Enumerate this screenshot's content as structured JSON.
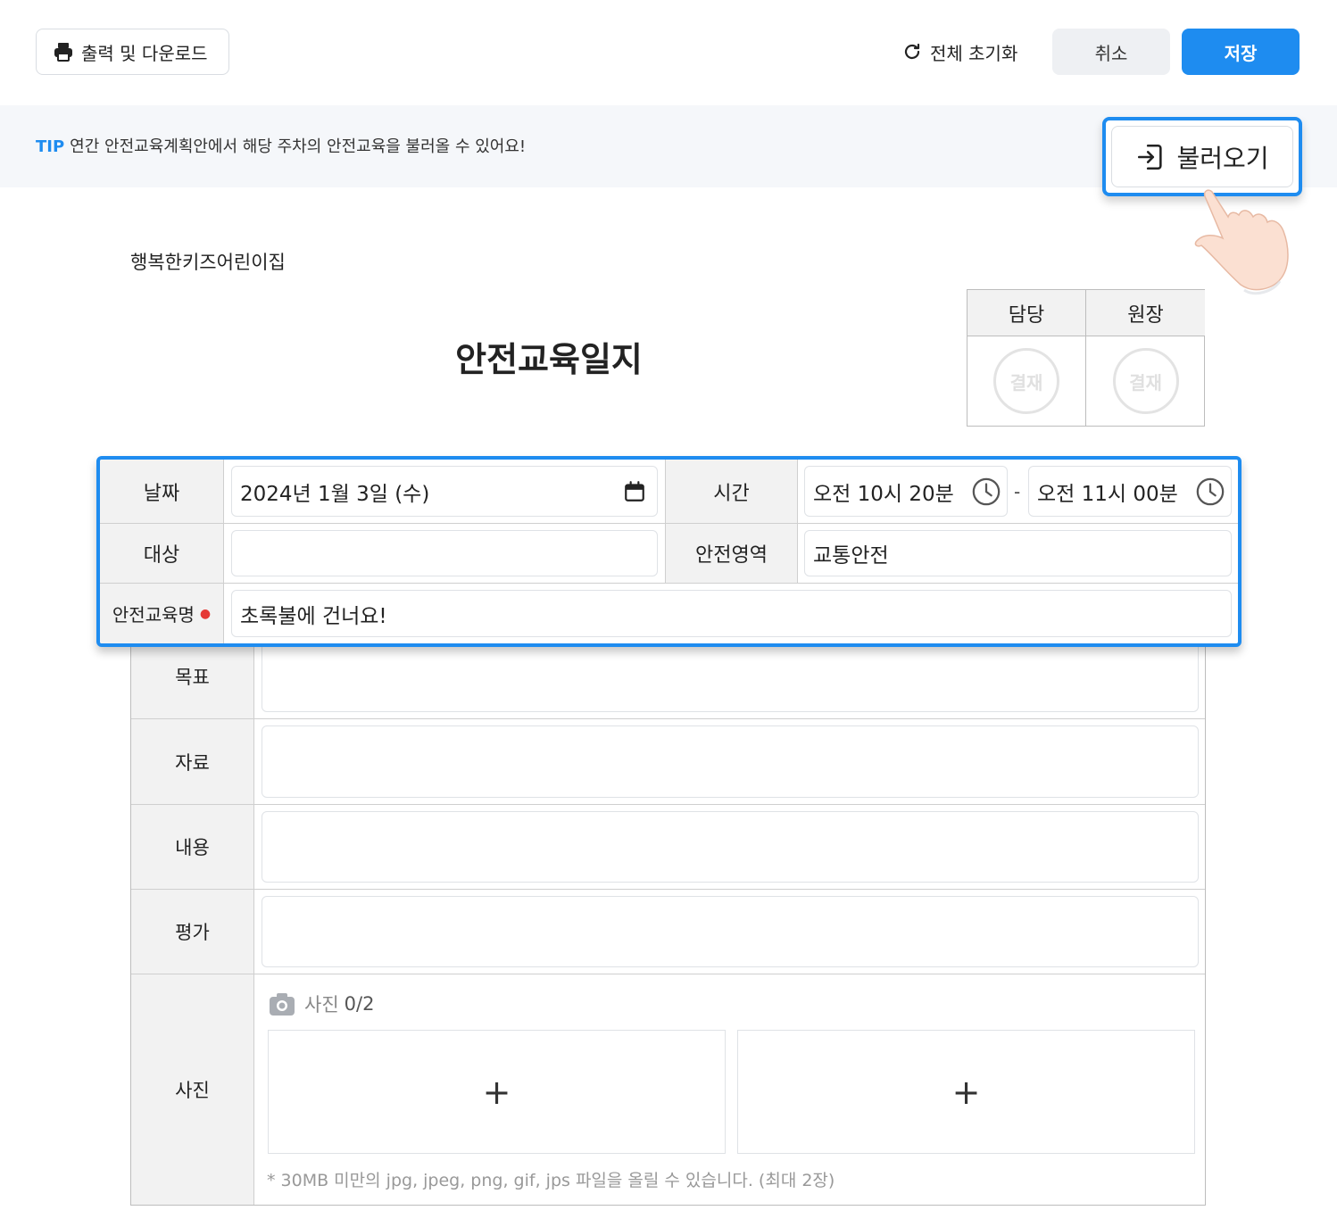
{
  "toolbar": {
    "print_label": "출력 및 다운로드",
    "reset_label": "전체 초기화",
    "cancel_label": "취소",
    "save_label": "저장"
  },
  "tip": {
    "label": "TIP",
    "text": "연간 안전교육계획안에서 해당 주차의 안전교육을 불러올 수 있어요!",
    "load_button": "불러오기"
  },
  "document": {
    "org_name": "행복한키즈어린이집",
    "title": "안전교육일지",
    "approval": {
      "headers": [
        "담당",
        "원장"
      ],
      "stamp_text": "결재"
    }
  },
  "form": {
    "date": {
      "label": "날짜",
      "value": "2024년 1월 3일 (수)"
    },
    "time": {
      "label": "시간",
      "start": "오전 10시 20분",
      "separator": "-",
      "end": "오전 11시 00분"
    },
    "target": {
      "label": "대상",
      "value": ""
    },
    "area": {
      "label": "안전영역",
      "value": "교통안전"
    },
    "name": {
      "label": "안전교육명",
      "required_mark": "●",
      "value": "초록불에 건너요!"
    },
    "goal": {
      "label": "목표",
      "value": ""
    },
    "material": {
      "label": "자료",
      "value": ""
    },
    "content": {
      "label": "내용",
      "value": ""
    },
    "evaluation": {
      "label": "평가",
      "value": ""
    },
    "photo": {
      "label": "사진",
      "counter_label": "사진",
      "counter": "0/2",
      "add_symbol": "+",
      "note": "* 30MB 미만의 jpg, jpeg, png, gif, jps 파일을 올릴 수 있습니다. (최대 2장)"
    }
  },
  "colors": {
    "accent": "#1e8cf0",
    "required": "#e53935",
    "label_bg": "#f2f2f2",
    "tip_bg": "#f5f7fa"
  },
  "icons": [
    "printer-icon",
    "refresh-icon",
    "login-arrow-icon",
    "calendar-icon",
    "clock-icon",
    "camera-icon",
    "pointing-hand-icon"
  ]
}
